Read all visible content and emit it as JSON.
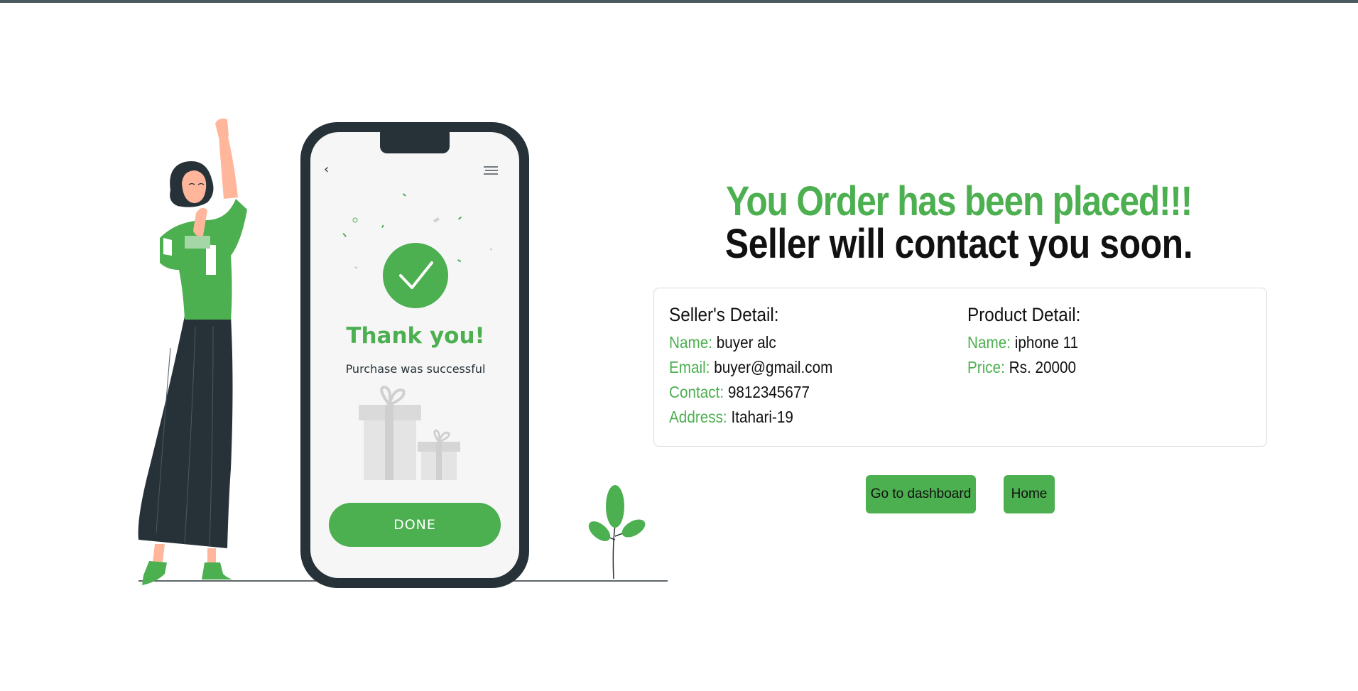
{
  "illustration": {
    "back_glyph": "‹",
    "thank_you": "Thank you!",
    "purchase_text": "Purchase was successful",
    "done_label": "DONE",
    "icons": [
      "woman-figure",
      "phone-frame",
      "check-icon",
      "gift-boxes",
      "plant",
      "hamburger-icon"
    ]
  },
  "headline": "You Order has been placed!!!",
  "subheadline": "Seller will contact you soon.",
  "seller": {
    "title": "Seller's Detail:",
    "fields": [
      {
        "label": "Name:",
        "value": "buyer alc"
      },
      {
        "label": "Email:",
        "value": "buyer@gmail.com"
      },
      {
        "label": "Contact:",
        "value": "9812345677"
      },
      {
        "label": "Address:",
        "value": "Itahari-19"
      }
    ]
  },
  "product": {
    "title": "Product Detail:",
    "fields": [
      {
        "label": "Name:",
        "value": "iphone 11"
      },
      {
        "label": "Price:",
        "value": "Rs. 20000"
      }
    ]
  },
  "buttons": {
    "dashboard": "Go to dashboard",
    "home": "Home"
  },
  "colors": {
    "accent": "#4caf50",
    "dark": "#263238",
    "text": "#111111"
  }
}
